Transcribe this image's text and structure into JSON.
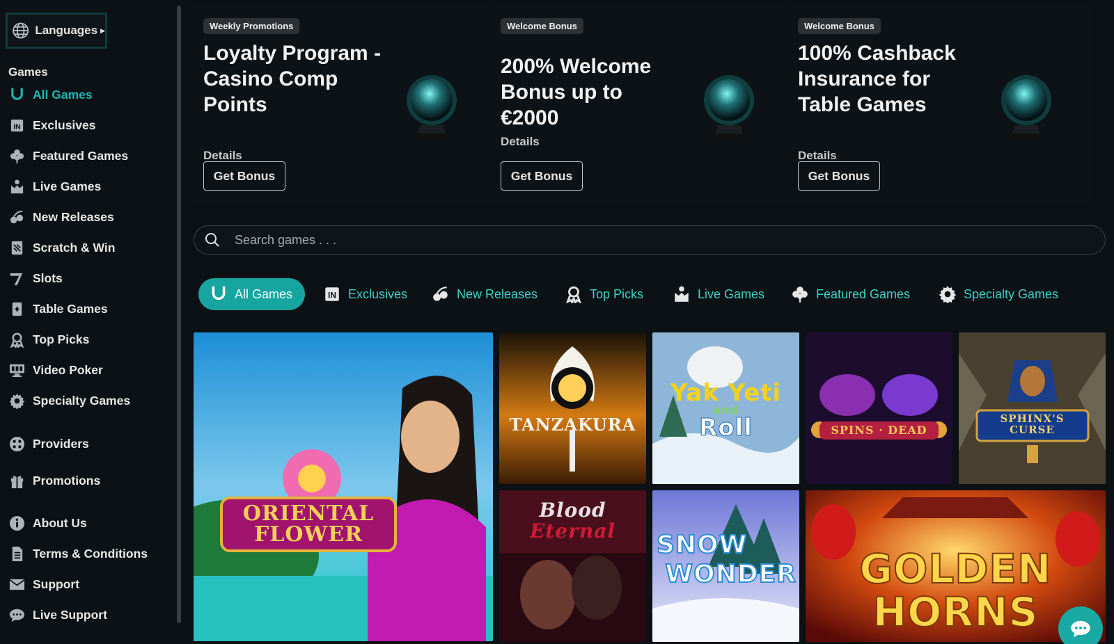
{
  "sidebar": {
    "languages_label": "Languages",
    "games_heading": "Games",
    "items": [
      {
        "label": "All Games",
        "icon": "horseshoe-icon"
      },
      {
        "label": "Exclusives",
        "icon": "exclusive-icon"
      },
      {
        "label": "Featured Games",
        "icon": "clover-icon"
      },
      {
        "label": "Live Games",
        "icon": "live-dealer-icon"
      },
      {
        "label": "New Releases",
        "icon": "cherries-icon"
      },
      {
        "label": "Scratch & Win",
        "icon": "scratch-icon"
      },
      {
        "label": "Slots",
        "icon": "slot-lever-icon"
      },
      {
        "label": "Table Games",
        "icon": "card-icon"
      },
      {
        "label": "Top Picks",
        "icon": "award-icon"
      },
      {
        "label": "Video Poker",
        "icon": "video-poker-icon"
      },
      {
        "label": "Specialty Games",
        "icon": "gear-icon"
      },
      {
        "label": "Providers",
        "icon": "dice-icon"
      },
      {
        "label": "Promotions",
        "icon": "gift-icon"
      },
      {
        "label": "About Us",
        "icon": "info-icon"
      },
      {
        "label": "Terms & Conditions",
        "icon": "document-icon"
      },
      {
        "label": "Support",
        "icon": "mail-icon"
      },
      {
        "label": "Live Support",
        "icon": "chat-icon"
      }
    ]
  },
  "promos": [
    {
      "badge": "Weekly Promotions",
      "title": "Loyalty Program - Casino Comp Points",
      "details": "Details",
      "button": "Get Bonus"
    },
    {
      "badge": "Welcome Bonus",
      "title": "200% Welcome Bonus up to €2000",
      "details": "Details",
      "button": "Get Bonus"
    },
    {
      "badge": "Welcome Bonus",
      "title": "100% Cashback Insurance for Table Games",
      "details": "Details",
      "button": "Get Bonus"
    }
  ],
  "search": {
    "placeholder": "Search games . . ."
  },
  "tabs": [
    {
      "label": "All Games",
      "icon": "horseshoe-icon"
    },
    {
      "label": "Exclusives",
      "icon": "exclusive-icon"
    },
    {
      "label": "New Releases",
      "icon": "cherries-icon"
    },
    {
      "label": "Top Picks",
      "icon": "award-icon"
    },
    {
      "label": "Live Games",
      "icon": "live-dealer-icon"
    },
    {
      "label": "Featured Games",
      "icon": "clover-icon"
    },
    {
      "label": "Specialty Games",
      "icon": "gear-icon"
    }
  ],
  "games": [
    {
      "title_line1": "ORIENTAL",
      "title_line2": "FLOWER"
    },
    {
      "title": "TANZAKURA"
    },
    {
      "title_line1": "Yak Yeti",
      "title_line2": "Roll",
      "title_mid": "and"
    },
    {
      "title": "SPINS · DEAD"
    },
    {
      "title_line1": "SPHINX'S",
      "title_line2": "CURSE"
    },
    {
      "title_line1": "Blood",
      "title_line2": "Eternal"
    },
    {
      "title_line1": "SNOW",
      "title_line2": "WONDER"
    },
    {
      "title_line1": "GOLDEN",
      "title_line2": "HORNS"
    }
  ],
  "colors": {
    "accent": "#1fb8b1",
    "background": "#0b1114",
    "card": "#0d1216"
  }
}
